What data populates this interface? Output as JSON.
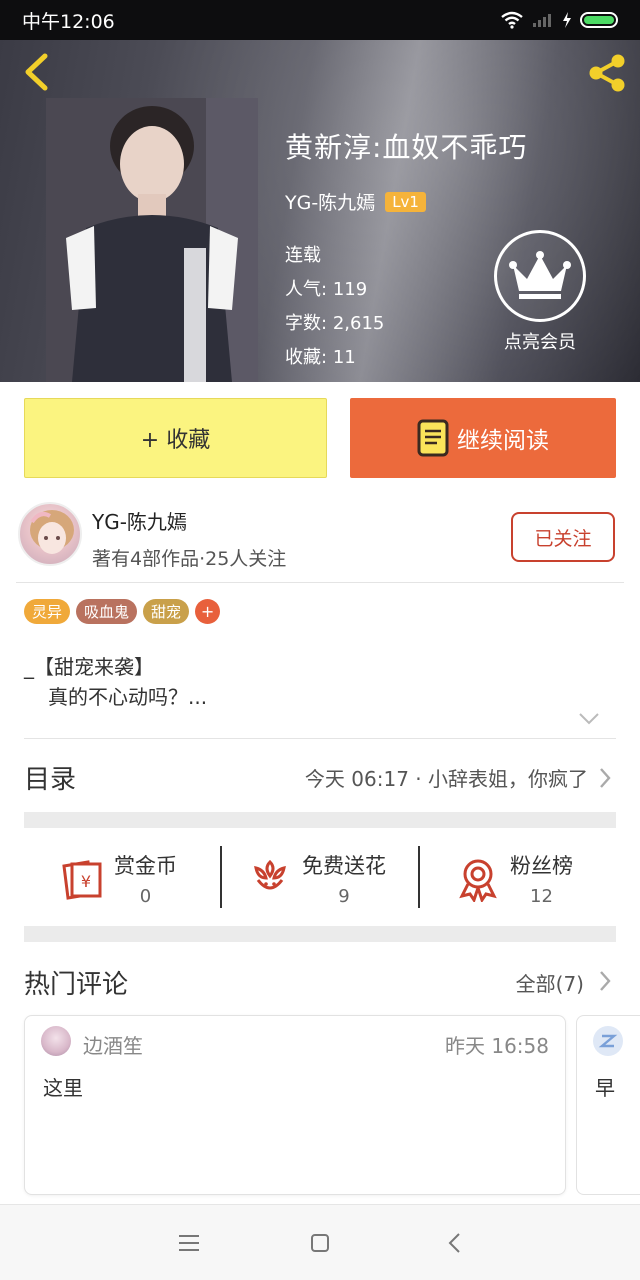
{
  "status_bar": {
    "time": "中午12:06"
  },
  "book": {
    "title": "黄新淳:血奴不乖巧",
    "author": "YG-陈九嫣",
    "level": "Lv1",
    "status": "连载",
    "popularity_label": "人气:",
    "popularity_value": "119",
    "word_count_label": "字数:",
    "word_count_value": "2,615",
    "favorites_label": "收藏:",
    "favorites_value": "11"
  },
  "vip": {
    "label": "点亮会员"
  },
  "actions": {
    "collect_label": "+ 收藏",
    "read_label": "继续阅读"
  },
  "author_card": {
    "name": "YG-陈九嫣",
    "stats": "著有4部作品·25人关注",
    "follow_label": "已关注"
  },
  "tags": [
    {
      "label": "灵异",
      "color": "#f0a93a"
    },
    {
      "label": "吸血鬼",
      "color": "#b9725f"
    },
    {
      "label": "甜宠",
      "color": "#c9a04a"
    }
  ],
  "synopsis": {
    "line1": "_【甜宠来袭】",
    "line2": "真的不心动吗？..."
  },
  "toc": {
    "label": "目录",
    "latest": "今天 06:17 · 小辞表姐，你疯了"
  },
  "stats": [
    {
      "label": "赏金币",
      "value": "0"
    },
    {
      "label": "免费送花",
      "value": "9"
    },
    {
      "label": "粉丝榜",
      "value": "12"
    }
  ],
  "comments_section": {
    "title": "热门评论",
    "all_label": "全部(7)"
  },
  "comments": [
    {
      "user": "边酒笙",
      "time": "昨天 16:58",
      "text": "这里"
    },
    {
      "user": "",
      "time": "",
      "text": "早"
    }
  ],
  "colors": {
    "accent_orange": "#ec6a3c",
    "collect_yellow": "#fbf480",
    "follow_red": "#c8412e",
    "icon_red": "#c8412e"
  }
}
